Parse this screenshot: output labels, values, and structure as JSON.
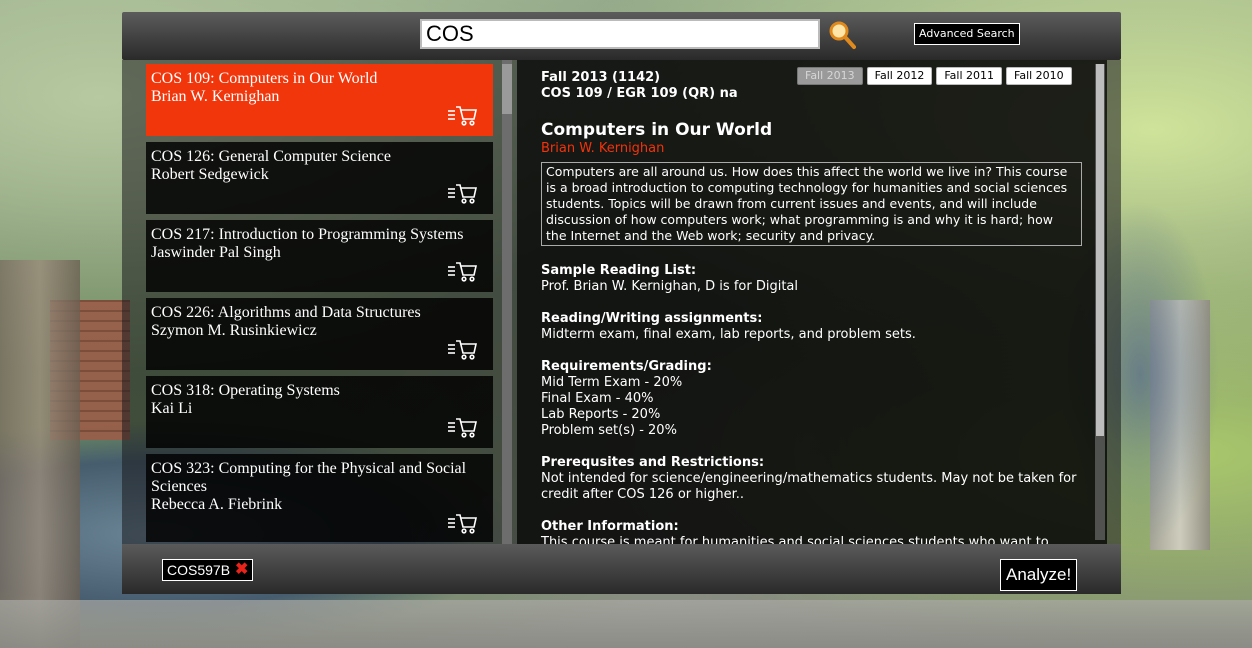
{
  "search": {
    "value": "COS",
    "advanced_label": "Advanced Search"
  },
  "courses": [
    {
      "code_title": "COS 109: Computers in Our World",
      "instructor": "Brian W. Kernighan"
    },
    {
      "code_title": "COS 126: General Computer Science",
      "instructor": "Robert Sedgewick"
    },
    {
      "code_title": "COS 217: Introduction to Programming Systems",
      "instructor": "Jaswinder Pal Singh"
    },
    {
      "code_title": "COS 226: Algorithms and Data Structures",
      "instructor": "Szymon M. Rusinkiewicz"
    },
    {
      "code_title": "COS 318: Operating Systems",
      "instructor": "Kai Li"
    },
    {
      "code_title": "COS 323: Computing for the Physical and Social Sciences",
      "instructor": "Rebecca A. Fiebrink"
    }
  ],
  "detail": {
    "term": "Fall 2013 (1142)",
    "listing": "COS 109 / EGR 109 (QR) na",
    "semesters": [
      "Fall 2013",
      "Fall 2012",
      "Fall 2011",
      "Fall 2010"
    ],
    "title": "Computers in Our World",
    "instructor": "Brian W. Kernighan",
    "description": "Computers are all around us. How does this affect the world we live in? This course is a broad introduction to computing technology for humanities and social sciences students. Topics will be drawn from current issues and events, and will include discussion of how computers work; what programming is and why it is hard; how the Internet and the Web work; security and privacy.",
    "reading_heading": "Sample Reading List:",
    "reading_text": "Prof. Brian W. Kernighan, D is for Digital",
    "assign_heading": "Reading/Writing assignments:",
    "assign_text": "Midterm exam, final exam, lab reports, and problem sets.",
    "grading_heading": "Requirements/Grading:",
    "grading_items": [
      "Mid Term Exam - 20%",
      "Final Exam - 40%",
      "Lab Reports - 20%",
      "Problem set(s) - 20%"
    ],
    "prereq_heading": "Prerequsites and Restrictions:",
    "prereq_text": "Not intended for science/engineering/mathematics students. May not be taken for credit after COS 126 or higher..",
    "other_heading": "Other Information:",
    "other_text": "This course is meant for humanities and social sciences students who want to"
  },
  "bottom": {
    "chip_label": "COS597B",
    "analyze_label": "Analyze!"
  }
}
